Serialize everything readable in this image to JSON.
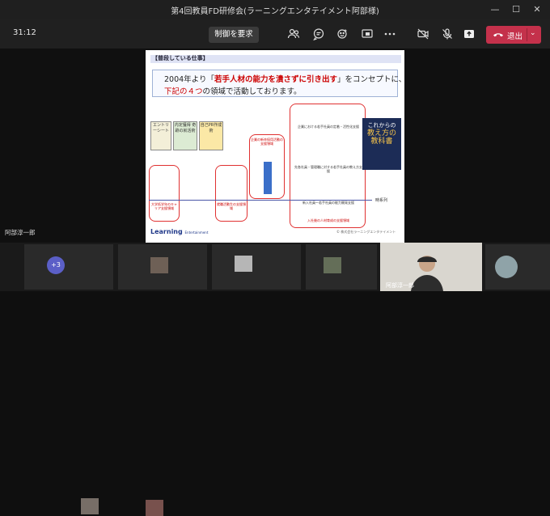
{
  "window": {
    "title": "第4回教員FD研修会(ラーニングエンタテイメント阿部様)",
    "minimize": "—",
    "maximize": "☐",
    "close": "✕"
  },
  "toolbar": {
    "timer": "31:12",
    "request_control": "制御を要求",
    "leave_label": "退出",
    "leave_color": "#c4314b"
  },
  "slide": {
    "section_heading": "【普段している仕事】",
    "headline_prefix": "2004年より「",
    "headline_emphasis": "若手人材の能力を潰さずに引き出す",
    "headline_suffix": "」をコンセプトに、",
    "subline_emphasis": "下記の４つ",
    "subline_suffix": "の領域で活動しております。",
    "timeline_label": "時系列",
    "stage_labels": [
      "大学低学年のキャリア支援領域",
      "就職活動生の支援領域",
      "企業の新卒採用活動の支援領域",
      "入社後の人材育成の支援領域"
    ],
    "books": [
      "エントリーシート",
      "内定獲得 奇跡の就活術",
      "自己PR作成術"
    ],
    "book_right_line1": "これからの",
    "book_right_line2": "教え方の",
    "book_right_line3": "教科書",
    "support_items": [
      "企業における若手社員の定着・活性化支援",
      "先各社員・管理職に対する若手社員の教え方支援",
      "新入社員～若手社員の能力開発支援"
    ],
    "logo_text": "Learning",
    "logo_sub": "Entertainment",
    "copyright": "© 株式会社ラーニングエンタテイメント"
  },
  "presenter": {
    "name": "阿部淳一郎"
  },
  "gallery": {
    "more_count": "+3",
    "self_name": "阿部淳一郎"
  }
}
